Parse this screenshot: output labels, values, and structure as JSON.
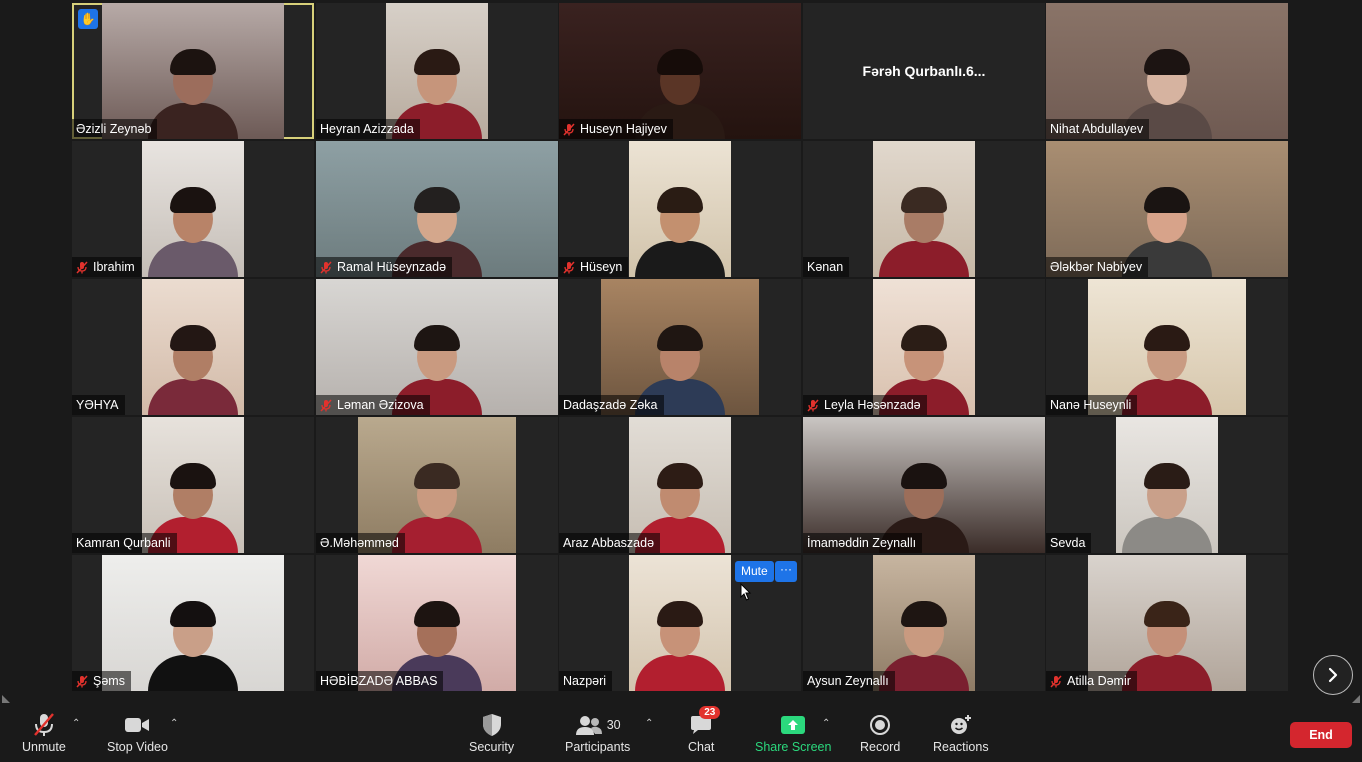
{
  "participants": [
    {
      "name": "Əzizli Zeynəb",
      "muted": false,
      "video": "mid",
      "c1": "#b7aaa7",
      "c2": "#6d5a56",
      "skin": "#9c6d5c",
      "hair": "#1c1310",
      "shirt": "#3a2320",
      "active": true,
      "hand": true
    },
    {
      "name": "Heyran Azizzada",
      "muted": false,
      "video": "narrow",
      "c1": "#d7d0c8",
      "c2": "#b7aa9d",
      "skin": "#c6957b",
      "hair": "#2a1a14",
      "shirt": "#8c1d2a"
    },
    {
      "name": "Huseyn Hajiyev",
      "muted": true,
      "video": "wide",
      "c1": "#3a2220",
      "c2": "#24130f",
      "skin": "#5a3526",
      "hair": "#160c09",
      "shirt": "#2a1a14"
    },
    {
      "name": "Fərəh  Qurbanlı.6...",
      "muted": false,
      "video": "none"
    },
    {
      "name": "Nihat Abdullayev",
      "muted": false,
      "video": "wide",
      "c1": "#8a7468",
      "c2": "#6f5a52",
      "skin": "#d6b3a0",
      "hair": "#1c1412",
      "shirt": "#5a4a46"
    },
    {
      "name": "Ibrahim",
      "muted": true,
      "video": "narrow",
      "c1": "#e8e4e0",
      "c2": "#c5beb7",
      "skin": "#b88368",
      "hair": "#1a1210",
      "shirt": "#6a5a6a"
    },
    {
      "name": "Ramal Hüseynzadə",
      "muted": true,
      "video": "wide",
      "c1": "#8ea0a4",
      "c2": "#6c7b7d",
      "skin": "#d4a78c",
      "hair": "#23201f",
      "shirt": "#4a2a2c"
    },
    {
      "name": "Hüseyn",
      "muted": true,
      "video": "narrow",
      "c1": "#ece3d4",
      "c2": "#d1c3aa",
      "skin": "#c3906f",
      "hair": "#2a1c14",
      "shirt": "#1a1a1a"
    },
    {
      "name": "Kənan",
      "muted": false,
      "video": "narrow",
      "c1": "#e1d8cd",
      "c2": "#c6b8a6",
      "skin": "#a97c66",
      "hair": "#3a2a22",
      "shirt": "#8c1d2a"
    },
    {
      "name": "Ələkbər Nəbiyev",
      "muted": false,
      "video": "wide",
      "c1": "#a98e72",
      "c2": "#7d6a58",
      "skin": "#d7a38a",
      "hair": "#1a1412",
      "shirt": "#3a3a3a"
    },
    {
      "name": "YƏHYA",
      "muted": false,
      "video": "narrow",
      "c1": "#ebdcd0",
      "c2": "#d2baa8",
      "skin": "#b07e65",
      "hair": "#231714",
      "shirt": "#7a2a3a"
    },
    {
      "name": "Ləman Əzizova",
      "muted": true,
      "video": "wide",
      "c1": "#d8d6d3",
      "c2": "#b6b1ad",
      "skin": "#c99a80",
      "hair": "#1d1512",
      "shirt": "#8c1d2a"
    },
    {
      "name": "Dadaşzadə Zəka",
      "muted": false,
      "video": "med",
      "c1": "#a88462",
      "c2": "#6d553f",
      "skin": "#b8836a",
      "hair": "#1f1612",
      "shirt": "#2d3b56"
    },
    {
      "name": "Leyla Həsənzadə",
      "muted": true,
      "video": "narrow",
      "c1": "#efe1d6",
      "c2": "#d8c0ad",
      "skin": "#c79379",
      "hair": "#2b1d16",
      "shirt": "#8c1d2a"
    },
    {
      "name": "Nanə Huseynli",
      "muted": false,
      "video": "med",
      "c1": "#eee5d5",
      "c2": "#d6c6ab",
      "skin": "#c99b82",
      "hair": "#2a1a14",
      "shirt": "#8c1d2a"
    },
    {
      "name": "Kamran Qurbanli",
      "muted": false,
      "video": "narrow",
      "c1": "#e7e2dc",
      "c2": "#c8c0b7",
      "skin": "#b07e65",
      "hair": "#1a1210",
      "shirt": "#b21f2f"
    },
    {
      "name": "Ə.Məhəmməd",
      "muted": false,
      "video": "med",
      "c1": "#b9a98e",
      "c2": "#8e7c62",
      "skin": "#c99a80",
      "hair": "#3a2a22",
      "shirt": "#a51f30"
    },
    {
      "name": "Araz Abbaszadə",
      "muted": false,
      "video": "narrow",
      "c1": "#e2ddd6",
      "c2": "#c6bdb2",
      "skin": "#c08b70",
      "hair": "#2d1c15",
      "shirt": "#b21f2f"
    },
    {
      "name": "İmaməddin Zeynallı",
      "muted": false,
      "video": "wide",
      "c1": "#cac6c3",
      "c2": "#3a2c28",
      "skin": "#9c6e5a",
      "hair": "#1a1210",
      "shirt": "#2a1a16"
    },
    {
      "name": "Sevda",
      "muted": false,
      "video": "narrow",
      "c1": "#e9e6e2",
      "c2": "#cbc6bf",
      "skin": "#c9a08a",
      "hair": "#2a1c16",
      "shirt": "#8c8a86"
    },
    {
      "name": "Şəms",
      "muted": true,
      "video": "mid",
      "c1": "#eeeeec",
      "c2": "#d8d6d3",
      "skin": "#c99f88",
      "hair": "#141010",
      "shirt": "#111111"
    },
    {
      "name": "HƏBİBZADƏ ABBAS",
      "muted": false,
      "video": "med",
      "c1": "#f0d8d5",
      "c2": "#d1aba7",
      "skin": "#a5705a",
      "hair": "#1d1411",
      "shirt": "#4a3a5a"
    },
    {
      "name": "Nazpəri",
      "muted": false,
      "video": "narrow",
      "c1": "#ece3d6",
      "c2": "#d3c4ae",
      "skin": "#c79278",
      "hair": "#2a1a14",
      "shirt": "#b21f2f"
    },
    {
      "name": "Aysun Zeynallı",
      "muted": false,
      "video": "narrow",
      "c1": "#c7b5a0",
      "c2": "#8e7b65",
      "skin": "#c99a80",
      "hair": "#1e1512",
      "shirt": "#7a1f2f"
    },
    {
      "name": "Atilla Dəmir",
      "muted": true,
      "video": "med",
      "c1": "#d9d3cd",
      "c2": "#b1a59a",
      "skin": "#c49079",
      "hair": "#3a2418",
      "shirt": "#8c1d2a"
    }
  ],
  "overlay": {
    "mute_label": "Mute",
    "more_label": "···"
  },
  "toolbar": {
    "unmute_label": "Unmute",
    "stop_video_label": "Stop Video",
    "security_label": "Security",
    "participants_label": "Participants",
    "participants_count": "30",
    "chat_label": "Chat",
    "chat_badge": "23",
    "share_label": "Share Screen",
    "record_label": "Record",
    "reactions_label": "Reactions",
    "end_label": "End"
  },
  "colors": {
    "accent": "#1e74e8",
    "share": "#2bd87d",
    "end": "#d4262e",
    "active_border": "#d7d07a"
  }
}
